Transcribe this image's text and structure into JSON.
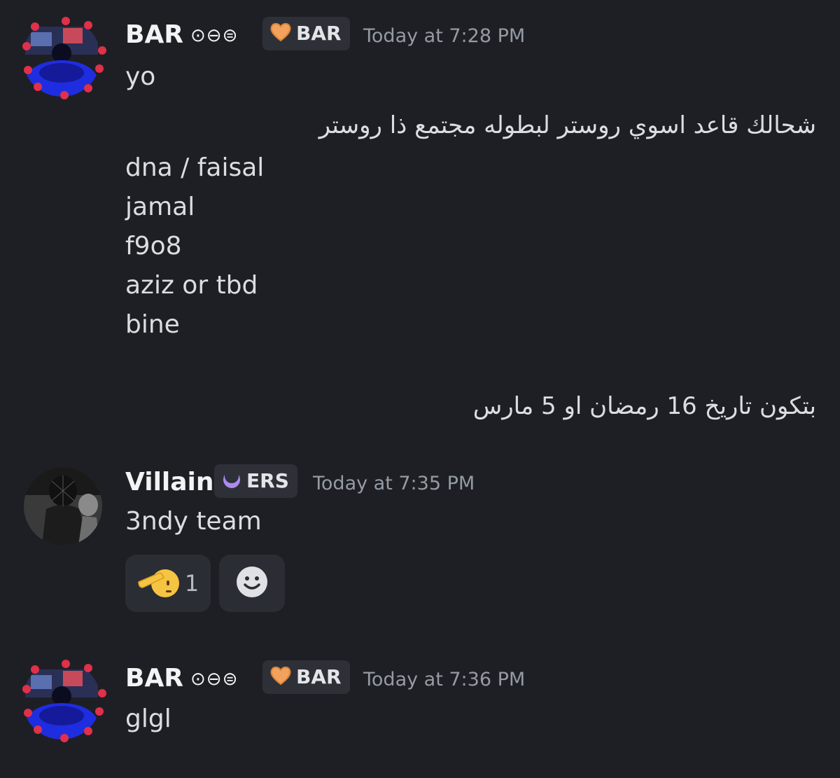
{
  "messages": [
    {
      "author": "BAR",
      "status_glyphs": "⊙⊖⊜",
      "tag": "BAR",
      "tag_icon": "orange-heart-icon",
      "timestamp": "Today at 7:28 PM",
      "lines": [
        "yo"
      ]
    },
    {
      "rtl_line_1": "شحالك قاعد اسوي روستر لبطوله مجتمع ذا روستر",
      "roster": [
        "dna / faisal",
        "jamal",
        "f9o8",
        "aziz or tbd",
        "bine"
      ],
      "rtl_line_2": "بتكون تاريخ 16 رمضان او 5 مارس"
    },
    {
      "author": "Villain",
      "tag": "ERS",
      "tag_icon": "purple-crescent-icon",
      "timestamp": "Today at 7:35 PM",
      "lines": [
        "3ndy team"
      ],
      "reactions": [
        {
          "icon": "saluting-face-emoji",
          "count": "1"
        },
        {
          "icon": "add-reaction-smiley-icon",
          "count": ""
        }
      ]
    },
    {
      "author": "BAR",
      "status_glyphs": "⊙⊖⊜",
      "tag": "BAR",
      "tag_icon": "orange-heart-icon",
      "timestamp": "Today at 7:36 PM",
      "lines": [
        "glgl"
      ]
    }
  ],
  "colors": {
    "background": "#1e1f24",
    "text": "#dbdee1",
    "username": "#f2f3f5",
    "timestamp": "#949ba4",
    "tag_bg": "#2e3037",
    "reaction_bg": "#2b2d34",
    "heart": "#f2a25c",
    "crescent": "#a98cf0"
  }
}
